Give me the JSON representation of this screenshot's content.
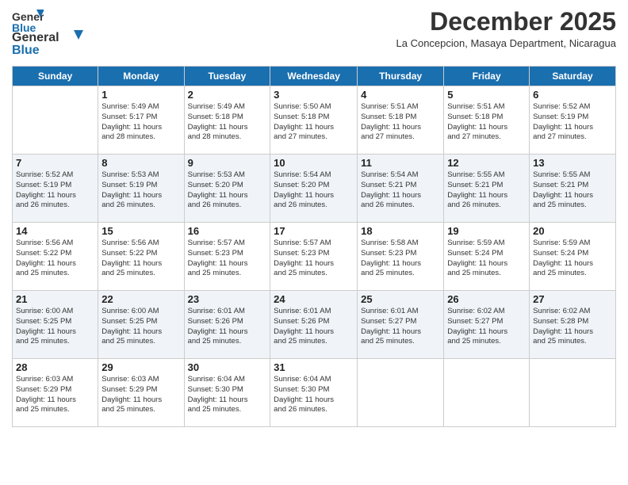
{
  "header": {
    "logo_line1": "General",
    "logo_line2": "Blue",
    "month": "December 2025",
    "location": "La Concepcion, Masaya Department, Nicaragua"
  },
  "weekdays": [
    "Sunday",
    "Monday",
    "Tuesday",
    "Wednesday",
    "Thursday",
    "Friday",
    "Saturday"
  ],
  "weeks": [
    [
      {
        "day": "",
        "info": ""
      },
      {
        "day": "1",
        "info": "Sunrise: 5:49 AM\nSunset: 5:17 PM\nDaylight: 11 hours\nand 28 minutes."
      },
      {
        "day": "2",
        "info": "Sunrise: 5:49 AM\nSunset: 5:18 PM\nDaylight: 11 hours\nand 28 minutes."
      },
      {
        "day": "3",
        "info": "Sunrise: 5:50 AM\nSunset: 5:18 PM\nDaylight: 11 hours\nand 27 minutes."
      },
      {
        "day": "4",
        "info": "Sunrise: 5:51 AM\nSunset: 5:18 PM\nDaylight: 11 hours\nand 27 minutes."
      },
      {
        "day": "5",
        "info": "Sunrise: 5:51 AM\nSunset: 5:18 PM\nDaylight: 11 hours\nand 27 minutes."
      },
      {
        "day": "6",
        "info": "Sunrise: 5:52 AM\nSunset: 5:19 PM\nDaylight: 11 hours\nand 27 minutes."
      }
    ],
    [
      {
        "day": "7",
        "info": "Sunrise: 5:52 AM\nSunset: 5:19 PM\nDaylight: 11 hours\nand 26 minutes."
      },
      {
        "day": "8",
        "info": "Sunrise: 5:53 AM\nSunset: 5:19 PM\nDaylight: 11 hours\nand 26 minutes."
      },
      {
        "day": "9",
        "info": "Sunrise: 5:53 AM\nSunset: 5:20 PM\nDaylight: 11 hours\nand 26 minutes."
      },
      {
        "day": "10",
        "info": "Sunrise: 5:54 AM\nSunset: 5:20 PM\nDaylight: 11 hours\nand 26 minutes."
      },
      {
        "day": "11",
        "info": "Sunrise: 5:54 AM\nSunset: 5:21 PM\nDaylight: 11 hours\nand 26 minutes."
      },
      {
        "day": "12",
        "info": "Sunrise: 5:55 AM\nSunset: 5:21 PM\nDaylight: 11 hours\nand 26 minutes."
      },
      {
        "day": "13",
        "info": "Sunrise: 5:55 AM\nSunset: 5:21 PM\nDaylight: 11 hours\nand 25 minutes."
      }
    ],
    [
      {
        "day": "14",
        "info": "Sunrise: 5:56 AM\nSunset: 5:22 PM\nDaylight: 11 hours\nand 25 minutes."
      },
      {
        "day": "15",
        "info": "Sunrise: 5:56 AM\nSunset: 5:22 PM\nDaylight: 11 hours\nand 25 minutes."
      },
      {
        "day": "16",
        "info": "Sunrise: 5:57 AM\nSunset: 5:23 PM\nDaylight: 11 hours\nand 25 minutes."
      },
      {
        "day": "17",
        "info": "Sunrise: 5:57 AM\nSunset: 5:23 PM\nDaylight: 11 hours\nand 25 minutes."
      },
      {
        "day": "18",
        "info": "Sunrise: 5:58 AM\nSunset: 5:23 PM\nDaylight: 11 hours\nand 25 minutes."
      },
      {
        "day": "19",
        "info": "Sunrise: 5:59 AM\nSunset: 5:24 PM\nDaylight: 11 hours\nand 25 minutes."
      },
      {
        "day": "20",
        "info": "Sunrise: 5:59 AM\nSunset: 5:24 PM\nDaylight: 11 hours\nand 25 minutes."
      }
    ],
    [
      {
        "day": "21",
        "info": "Sunrise: 6:00 AM\nSunset: 5:25 PM\nDaylight: 11 hours\nand 25 minutes."
      },
      {
        "day": "22",
        "info": "Sunrise: 6:00 AM\nSunset: 5:25 PM\nDaylight: 11 hours\nand 25 minutes."
      },
      {
        "day": "23",
        "info": "Sunrise: 6:01 AM\nSunset: 5:26 PM\nDaylight: 11 hours\nand 25 minutes."
      },
      {
        "day": "24",
        "info": "Sunrise: 6:01 AM\nSunset: 5:26 PM\nDaylight: 11 hours\nand 25 minutes."
      },
      {
        "day": "25",
        "info": "Sunrise: 6:01 AM\nSunset: 5:27 PM\nDaylight: 11 hours\nand 25 minutes."
      },
      {
        "day": "26",
        "info": "Sunrise: 6:02 AM\nSunset: 5:27 PM\nDaylight: 11 hours\nand 25 minutes."
      },
      {
        "day": "27",
        "info": "Sunrise: 6:02 AM\nSunset: 5:28 PM\nDaylight: 11 hours\nand 25 minutes."
      }
    ],
    [
      {
        "day": "28",
        "info": "Sunrise: 6:03 AM\nSunset: 5:29 PM\nDaylight: 11 hours\nand 25 minutes."
      },
      {
        "day": "29",
        "info": "Sunrise: 6:03 AM\nSunset: 5:29 PM\nDaylight: 11 hours\nand 25 minutes."
      },
      {
        "day": "30",
        "info": "Sunrise: 6:04 AM\nSunset: 5:30 PM\nDaylight: 11 hours\nand 25 minutes."
      },
      {
        "day": "31",
        "info": "Sunrise: 6:04 AM\nSunset: 5:30 PM\nDaylight: 11 hours\nand 26 minutes."
      },
      {
        "day": "",
        "info": ""
      },
      {
        "day": "",
        "info": ""
      },
      {
        "day": "",
        "info": ""
      }
    ]
  ]
}
